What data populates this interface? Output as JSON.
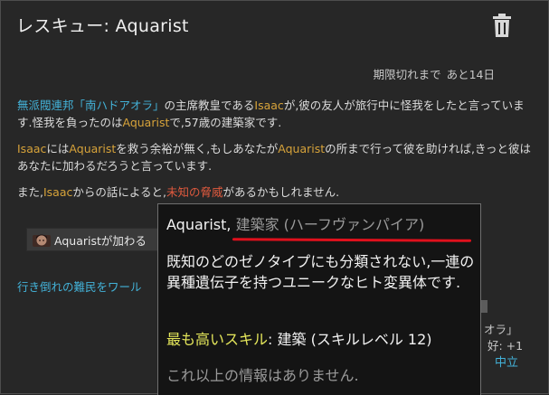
{
  "window": {
    "title": "レスキュー: Aquarist"
  },
  "expiry": {
    "label": "期限切れまで",
    "value": "あと14日"
  },
  "body": {
    "p1": {
      "faction": "無派閥連邦「南ハドアオラ」",
      "t1": "の主席教皇である",
      "isaac": "Isaac",
      "t2": "が,彼の友人が旅行中に怪我をしたと言っています.怪我を負ったのは",
      "aquarist": "Aquarist",
      "t3": "で,57歳の建築家です."
    },
    "p2": {
      "isaac": "Isaac",
      "t1": "には",
      "aquarist1": "Aquarist",
      "t2": "を救う余裕が無く,もしあなたが",
      "aquarist2": "Aquarist",
      "t3": "の所まで行って彼を助ければ,きっと彼はあなたに加わるだろうと言っています."
    },
    "p3": {
      "t1": "また,",
      "isaac": "Isaac",
      "t2": "からの話によると,",
      "threat": "未知の脅威",
      "t3": "があるかもしれません."
    }
  },
  "join_button": {
    "label": "Aquaristが加わる"
  },
  "link_text": "行き倒れの難民をワール",
  "peek": {
    "line1": "オラ」",
    "line2": "好: +1",
    "neutral": "中立"
  },
  "tooltip": {
    "name": "Aquarist,",
    "role": "建築家 (ハーフヴァンパイア)",
    "description": "既知のどのゼノタイプにも分類されない,一連の異種遺伝子を持つユニークなヒト変異体です.",
    "skill_label": "最も高いスキル",
    "skill_value": ": 建築 (スキルレベル 12)",
    "no_more": "これ以上の情報はありません."
  },
  "colors": {
    "background": "#272727",
    "link_blue": "#43b2d8",
    "name_orange": "#d7a33a",
    "threat_red": "#e05a3e",
    "skill_yellow": "#e5e75b",
    "underline_red": "#e0101c"
  }
}
